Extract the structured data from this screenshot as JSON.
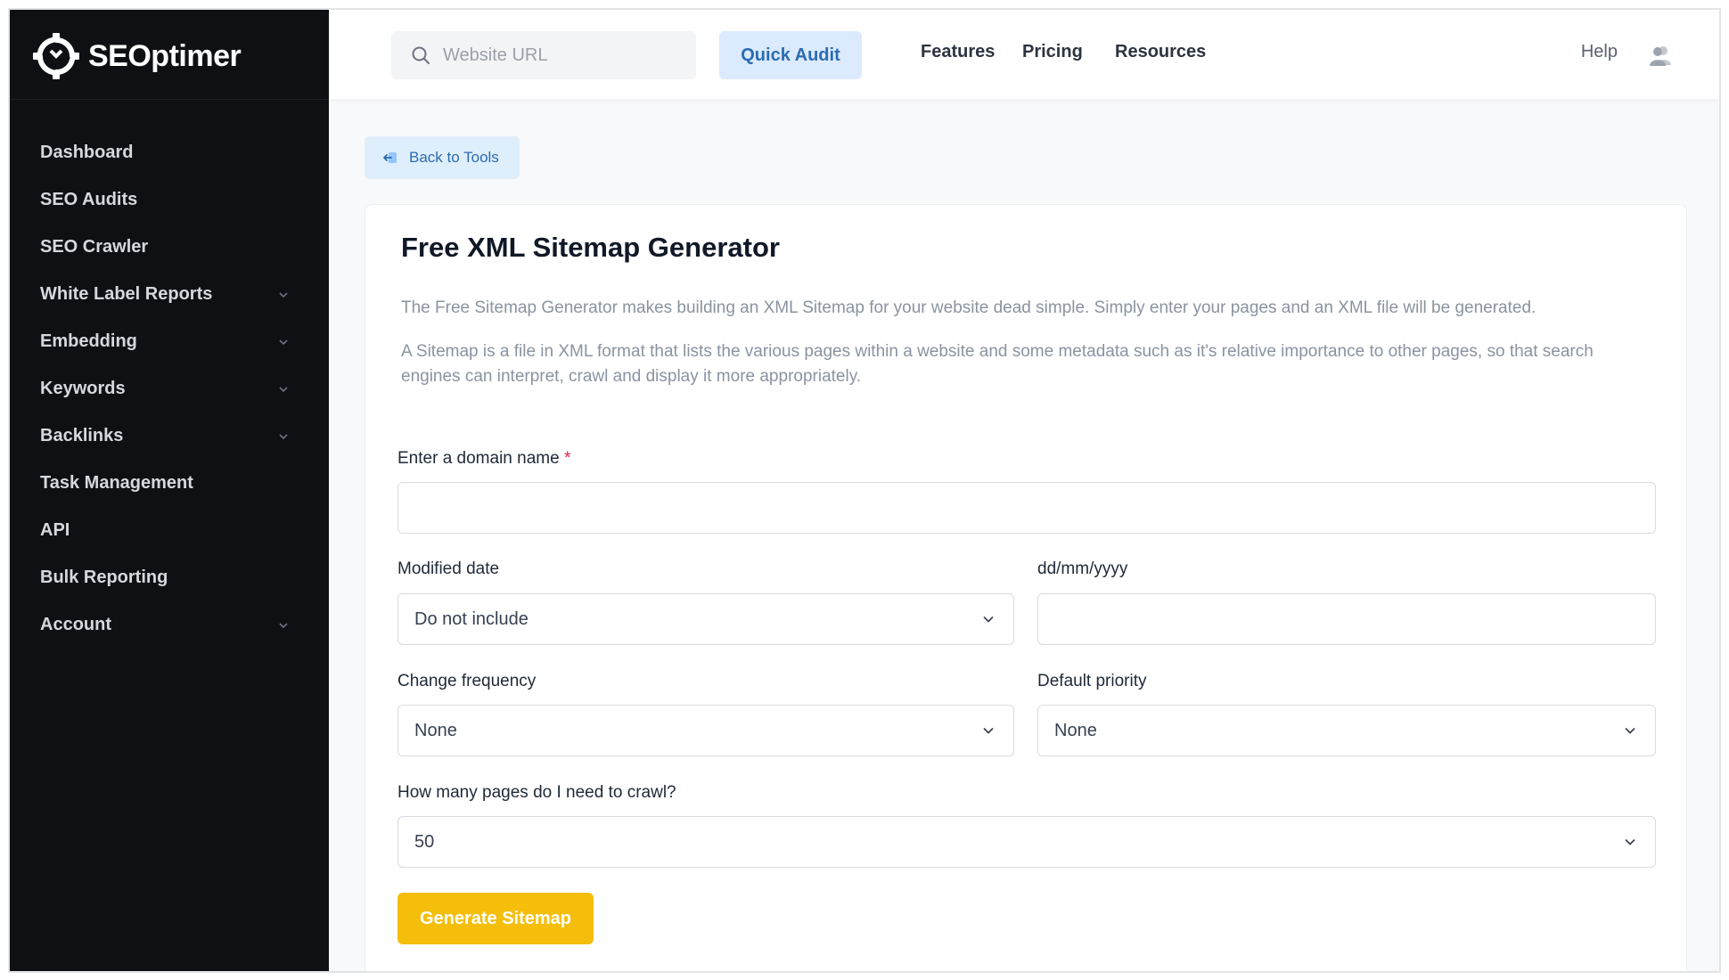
{
  "brand": {
    "name": "SEOptimer"
  },
  "sidebar": {
    "items": [
      {
        "label": "Dashboard",
        "has_submenu": false
      },
      {
        "label": "SEO Audits",
        "has_submenu": false
      },
      {
        "label": "SEO Crawler",
        "has_submenu": false
      },
      {
        "label": "White Label Reports",
        "has_submenu": true
      },
      {
        "label": "Embedding",
        "has_submenu": true
      },
      {
        "label": "Keywords",
        "has_submenu": true
      },
      {
        "label": "Backlinks",
        "has_submenu": true
      },
      {
        "label": "Task Management",
        "has_submenu": false
      },
      {
        "label": "API",
        "has_submenu": false
      },
      {
        "label": "Bulk Reporting",
        "has_submenu": false
      },
      {
        "label": "Account",
        "has_submenu": true
      }
    ]
  },
  "topbar": {
    "search_placeholder": "Website URL",
    "quick_audit_label": "Quick Audit",
    "nav": [
      "Features",
      "Pricing",
      "Resources"
    ],
    "help_label": "Help"
  },
  "main": {
    "back_label": "Back to Tools",
    "title": "Free XML Sitemap Generator",
    "description_1": "The Free Sitemap Generator makes building an XML Sitemap for your website dead simple. Simply enter your pages and an XML file will be generated.",
    "description_2": "A Sitemap is a file in XML format that lists the various pages within a website and some metadata such as it's relative importance to other pages, so that search engines can interpret, crawl and display it more appropriately.",
    "domain_label": "Enter a domain name",
    "required_mark": "*",
    "domain_value": "",
    "modified_date_label": "Modified date",
    "modified_date_value": "Do not include",
    "date_format_label": "dd/mm/yyyy",
    "date_value": "",
    "change_frequency_label": "Change frequency",
    "change_frequency_value": "None",
    "default_priority_label": "Default priority",
    "default_priority_value": "None",
    "pages_label": "How many pages do I need to crawl?",
    "pages_value": "50",
    "generate_label": "Generate Sitemap"
  },
  "colors": {
    "sidebar_bg": "#0f1014",
    "accent_blue": "#2b6cb0",
    "generate_button": "#f5be0b",
    "required": "#e11d48"
  }
}
